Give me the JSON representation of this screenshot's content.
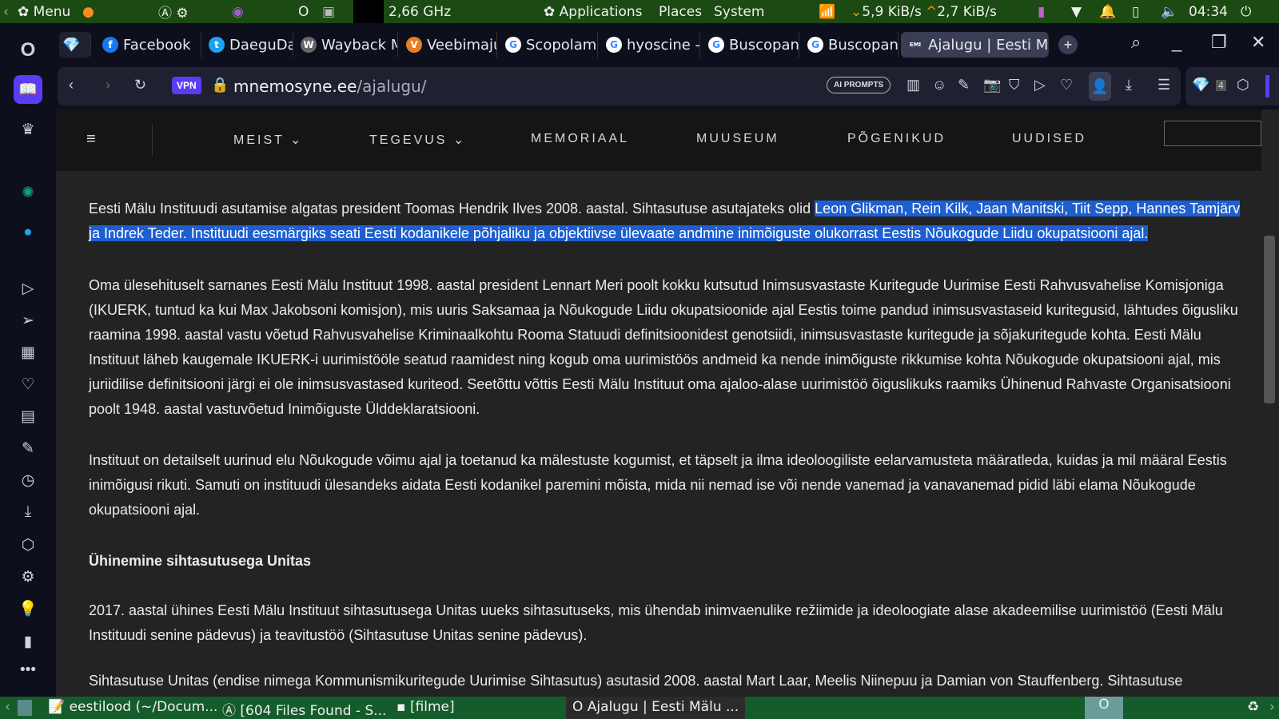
{
  "topbar": {
    "menu": "Menu",
    "cpu": "2,66 GHz",
    "applications": "Applications",
    "places": "Places",
    "system": "System",
    "down": "5,9 KiB/s",
    "up": "2,7 KiB/s",
    "time": "04:34"
  },
  "tabs": [
    {
      "label": "Facebook",
      "icon": "f",
      "color": "#1877f2"
    },
    {
      "label": "DaeguDav",
      "icon": "t",
      "color": "#1da1f2"
    },
    {
      "label": "Wayback M",
      "icon": "W",
      "color": "#666"
    },
    {
      "label": "Veebimaju",
      "icon": "V",
      "color": "#e67e22"
    },
    {
      "label": "Scopolami",
      "icon": "G",
      "color": "#fff"
    },
    {
      "label": "hyoscine -",
      "icon": "G",
      "color": "#fff"
    },
    {
      "label": "Buscopan",
      "icon": "G",
      "color": "#fff"
    },
    {
      "label": "Buscopan",
      "icon": "G",
      "color": "#fff"
    },
    {
      "label": "Ajalugu | Eesti Mä",
      "icon": "EMI",
      "color": "#3a3e55"
    }
  ],
  "address": {
    "vpn": "VPN",
    "domain": "mnemosyne.ee",
    "path": "/ajalugu/",
    "ai_prompts": "AI PROMPTS",
    "badge": "4"
  },
  "nav": [
    "MEIST",
    "TEGEVUS",
    "MEMORIAAL",
    "MUUSEUM",
    "PÕGENIKUD",
    "UUDISED"
  ],
  "content": {
    "p1_plain": "Eesti Mälu Instituudi asutamise algatas president Toomas Hendrik Ilves 2008. aastal. Sihtasutuse asutajateks olid ",
    "p1_selected": "Leon Glikman, Rein Kilk, Jaan Manitski, Tiit Sepp, Hannes Tamjärv ja Indrek Teder. Instituudi eesmärgiks seati Eesti kodanikele põhjaliku ja objektiivse ülevaate andmine inimõiguste olukorrast Eestis Nõukogude Liidu okupatsiooni ajal.",
    "p2": "Oma ülesehituselt sarnanes Eesti Mälu Instituut 1998. aastal president Lennart Meri poolt kokku kutsutud Inimsusvastaste Kuritegude Uurimise Eesti Rahvusvahelise Komisjoniga (IKUERK, tuntud ka kui Max Jakobsoni komisjon), mis uuris Saksamaa ja Nõukogude Liidu okupatsioonide ajal Eestis toime pandud inimsusvastaseid kuritegusid, lähtudes õigusliku raamina 1998. aastal vastu võetud Rahvusvahelise Kriminaalkohtu Rooma Statuudi definitsioonidest genotsiidi, inimsusvastaste kuritegude ja sõjakuritegude kohta. Eesti Mälu Instituut läheb kaugemale IKUERK-i uurimistööle seatud raamidest ning kogub oma uurimistöös andmeid ka nende inimõiguste rikkumise kohta Nõukogude okupatsiooni ajal, mis juriidilise definitsiooni järgi ei ole inimsusvastased kuriteod. Seetõttu võttis Eesti Mälu Instituut oma ajaloo-alase uurimistöö õiguslikuks raamiks Ühinenud Rahvaste Organisatsiooni poolt 1948. aastal vastuvõetud Inimõiguste Ülddeklaratsiooni.",
    "p3": "Instituut on detailselt uurinud elu Nõukogude võimu ajal ja toetanud ka mälestuste kogumist, et täpselt ja ilma ideoloogiliste eelarvamusteta määratleda, kuidas ja mil määral Eestis inimõigusi rikuti. Samuti on instituudi ülesandeks aidata Eesti kodanikel paremini mõista, mida nii nemad ise või nende vanemad ja vanavanemad pidid läbi elama Nõukogude okupatsiooni ajal.",
    "h1": "Ühinemine sihtasutusega Unitas",
    "p4": "2017. aastal ühines Eesti Mälu Instituut sihtasutusega Unitas uueks sihtasutuseks, mis ühendab inimvaenulike režiimide ja ideoloogiate alase akadeemilise uurimistöö (Eesti Mälu Instituudi senine pädevus) ja teavitustöö (Sihtasutuse Unitas senine pädevus).",
    "p5": "Sihtasutuse Unitas (endise nimega Kommunismikuritegude Uurimise Sihtasutus) asutasid 2008. aastal Mart Laar, Meelis Niinepuu ja Damian von Stauffenberg. Sihtasutuse"
  },
  "taskbar": [
    "eestilood (~/Docum...",
    "[604 Files Found - S...",
    "[filme]",
    "Ajalugu | Eesti Mälu ..."
  ]
}
